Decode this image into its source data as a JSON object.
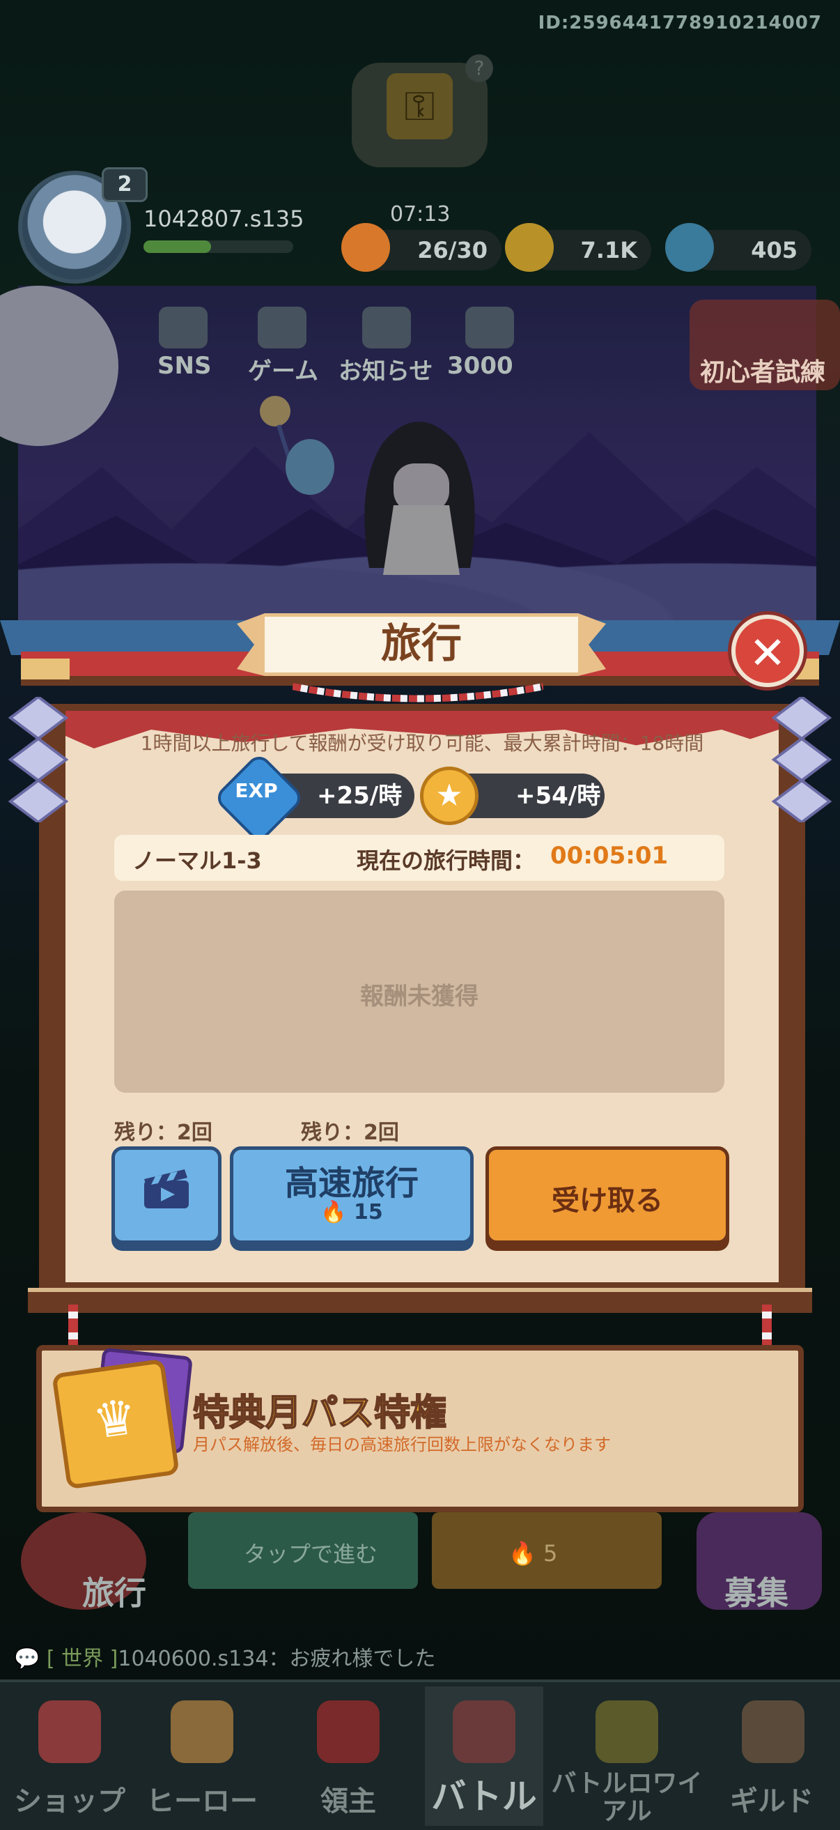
{
  "header": {
    "user_id": "ID:2596441778910214007",
    "level": "2",
    "player_name": "1042807.s135",
    "timer": "07:13",
    "resources": [
      {
        "icon": "flame-icon",
        "value": "26/30"
      },
      {
        "icon": "coin-icon",
        "value": "7.1K"
      },
      {
        "icon": "crystal-icon",
        "value": "405"
      }
    ]
  },
  "menu": [
    {
      "label": "SNS",
      "icon": "x-logo-icon"
    },
    {
      "label": "ゲーム",
      "icon": "game-icon"
    },
    {
      "label": "お知らせ",
      "icon": "megaphone-icon"
    },
    {
      "label": "3000",
      "icon": "calendar-check-icon"
    }
  ],
  "right_event": {
    "label": "初心者試練"
  },
  "modal": {
    "title": "旅行",
    "close_icon": "✕",
    "info": "1時間以上旅行して報酬が受け取り可能、最大累計時間：18時間",
    "rates": [
      {
        "icon": "exp-icon",
        "icon_label": "EXP",
        "value": "+25/時"
      },
      {
        "icon": "coin-icon",
        "icon_label": "★",
        "value": "+54/時"
      }
    ],
    "stage": "ノーマル1-3",
    "time_label": "現在の旅行時間：",
    "time_value": "00:05:01",
    "reward_empty": "報酬未獲得",
    "remaining_ad": "残り：2回",
    "remaining_fast": "残り：2回",
    "fast_travel_label": "高速旅行",
    "fast_travel_cost": "15",
    "claim_label": "受け取る"
  },
  "monthly_pass": {
    "title": "特典月パス特権",
    "description": "月パス解放後、毎日の高速旅行回数上限がなくなります"
  },
  "background": {
    "travel_label": "旅行",
    "left_panel_text": "タップで進む",
    "right_panel_cost": "5",
    "recruit_label": "募集"
  },
  "chat": {
    "channel": "[ 世界 ]",
    "message": "1040600.s134：お疲れ様でした"
  },
  "tabs": [
    {
      "label": "ショップ",
      "icon": "shop-icon",
      "active": false
    },
    {
      "label": "ヒーロー",
      "icon": "hero-icon",
      "active": false
    },
    {
      "label": "領主",
      "icon": "lord-icon",
      "active": false
    },
    {
      "label": "バトル",
      "icon": "sword-icon",
      "active": true
    },
    {
      "label": "バトルロワイアル",
      "icon": "eye-icon",
      "active": false
    },
    {
      "label": "ギルド",
      "icon": "guild-icon",
      "active": false
    }
  ],
  "colors": {
    "accent_orange": "#f09a34",
    "accent_blue": "#6fb3e6",
    "close_red": "#d9463c",
    "time_orange": "#e07a18",
    "panel_cream": "#efdcc3"
  }
}
